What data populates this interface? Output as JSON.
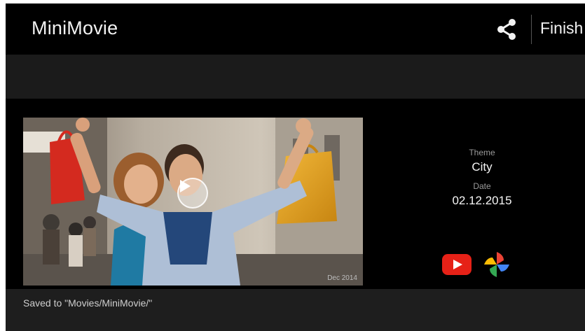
{
  "app": {
    "title": "MiniMovie",
    "finish_label": "Finish"
  },
  "icons": {
    "share": "share-icon",
    "play": "play-icon",
    "youtube": "youtube-icon",
    "photos": "google-photos-icon"
  },
  "video": {
    "thumbnail_caption": "Dec 2014"
  },
  "info": {
    "theme_label": "Theme",
    "theme_value": "City",
    "date_label": "Date",
    "date_value": "02.12.2015"
  },
  "footer": {
    "saved_text": "Saved to \"Movies/MiniMovie/\""
  },
  "colors": {
    "topbar": "#000000",
    "band": "#1b1b1b",
    "content": "#000000",
    "footer": "#1e1e1e",
    "youtube_red": "#e62117"
  }
}
